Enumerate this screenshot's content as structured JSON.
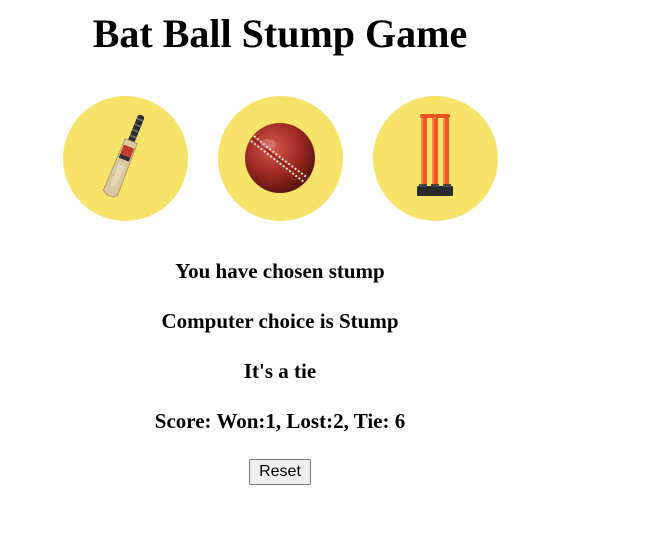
{
  "app": {
    "title": "Bat Ball Stump Game"
  },
  "choices": [
    {
      "id": "bat",
      "icon": "cricket-bat-icon"
    },
    {
      "id": "ball",
      "icon": "cricket-ball-icon"
    },
    {
      "id": "stump",
      "icon": "cricket-stumps-icon"
    }
  ],
  "result": {
    "user_choice": "You have chosen stump",
    "computer_choice": "Computer choice is Stump",
    "outcome": "It's a tie",
    "score": "Score: Won:1, Lost:2, Tie: 6"
  },
  "controls": {
    "reset_label": "Reset"
  },
  "colors": {
    "circle": "#f7e36a"
  }
}
